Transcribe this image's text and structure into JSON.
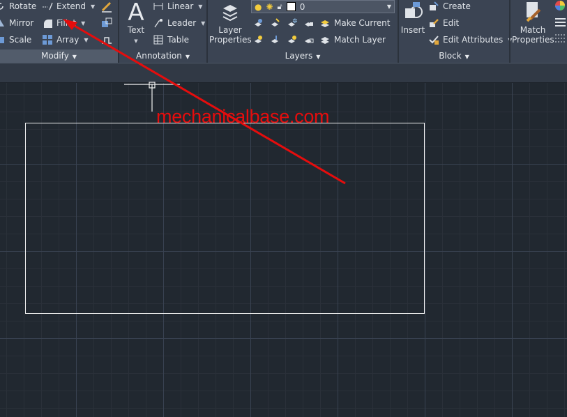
{
  "modify": {
    "title": "Modify",
    "tools": {
      "rotate": "Rotate",
      "mirror": "Mirror",
      "scale": "Scale",
      "extend": "Extend",
      "fillet": "Fillet",
      "array": "Array"
    }
  },
  "annotation": {
    "title": "Annotation",
    "text_label": "Text",
    "linear": "Linear",
    "leader": "Leader",
    "table": "Table"
  },
  "layers": {
    "title": "Layers",
    "layer_properties_line1": "Layer",
    "layer_properties_line2": "Properties",
    "current_layer": "0",
    "make_current": "Make Current",
    "match_layer": "Match Layer"
  },
  "block": {
    "title": "Block",
    "insert": "Insert",
    "create": "Create",
    "edit": "Edit",
    "edit_attributes": "Edit Attributes"
  },
  "properties": {
    "match_line1": "Match",
    "match_line2": "Properties"
  },
  "watermark": "mechanicalbase.com",
  "colors": {
    "ribbon_bg": "#3b4453",
    "canvas_bg": "#212830",
    "annotation_red": "#e50d0d",
    "geometry_white": "#f2f2f2"
  }
}
